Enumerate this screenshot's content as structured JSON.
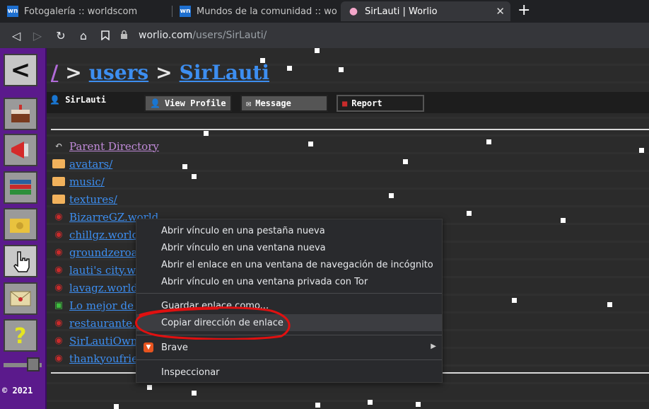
{
  "browser": {
    "tabs": [
      {
        "title": "Fotogalería :: worldscom",
        "favicon": "wn",
        "active": false
      },
      {
        "title": "Mundos de la comunidad :: worlio",
        "favicon": "wn",
        "active": false
      },
      {
        "title": "SirLauti | Worlio",
        "favicon": "brain",
        "active": true
      }
    ],
    "url_host": "worlio.com",
    "url_path": "/users/SirLauti/"
  },
  "sidebar": {
    "copyright": "© 2021",
    "buttons": [
      "back-arrow-icon",
      "cake-icon",
      "megaphone-icon",
      "books-icon",
      "cheese-icon",
      "hand-cursor-icon",
      "envelope-icon",
      "question-icon"
    ]
  },
  "breadcrumb": {
    "root": "/",
    "sep": ">",
    "users": "users",
    "user": "SirLauti"
  },
  "userbar": {
    "name": "SirLauti",
    "view_profile": "View Profile",
    "message": "Message",
    "report": "Report"
  },
  "listing": [
    {
      "type": "parent",
      "name": "Parent Directory"
    },
    {
      "type": "folder",
      "name": "avatars/"
    },
    {
      "type": "folder",
      "name": "music/"
    },
    {
      "type": "folder",
      "name": "textures/"
    },
    {
      "type": "world",
      "name": "BizarreGZ.world"
    },
    {
      "type": "world",
      "name": "chillgz.world"
    },
    {
      "type": "world",
      "name": "groundzeroatla"
    },
    {
      "type": "world",
      "name": "lauti's city.wor"
    },
    {
      "type": "world",
      "name": "lavagz.world"
    },
    {
      "type": "image",
      "name": "Lo mejor de lo"
    },
    {
      "type": "world",
      "name": "restaurante.wo"
    },
    {
      "type": "world",
      "name": "SirLautiOwnC"
    },
    {
      "type": "world",
      "name": "thankyoufriend"
    }
  ],
  "context_menu": {
    "items": [
      "Abrir vínculo en una pestaña nueva",
      "Abrir vínculo en una ventana nueva",
      "Abrir el enlace en una ventana de navegación de incógnito",
      "Abrir vínculo en una ventana privada con Tor",
      "Guardar enlace como...",
      "Copiar dirección de enlace",
      "Brave",
      "Inspeccionar"
    ],
    "highlighted": "Copiar dirección de enlace"
  },
  "colors": {
    "link": "#3d8ef0",
    "visited_link": "#b16bd8",
    "sidebar": "#5b1a8c",
    "annotation": "#e01010"
  }
}
